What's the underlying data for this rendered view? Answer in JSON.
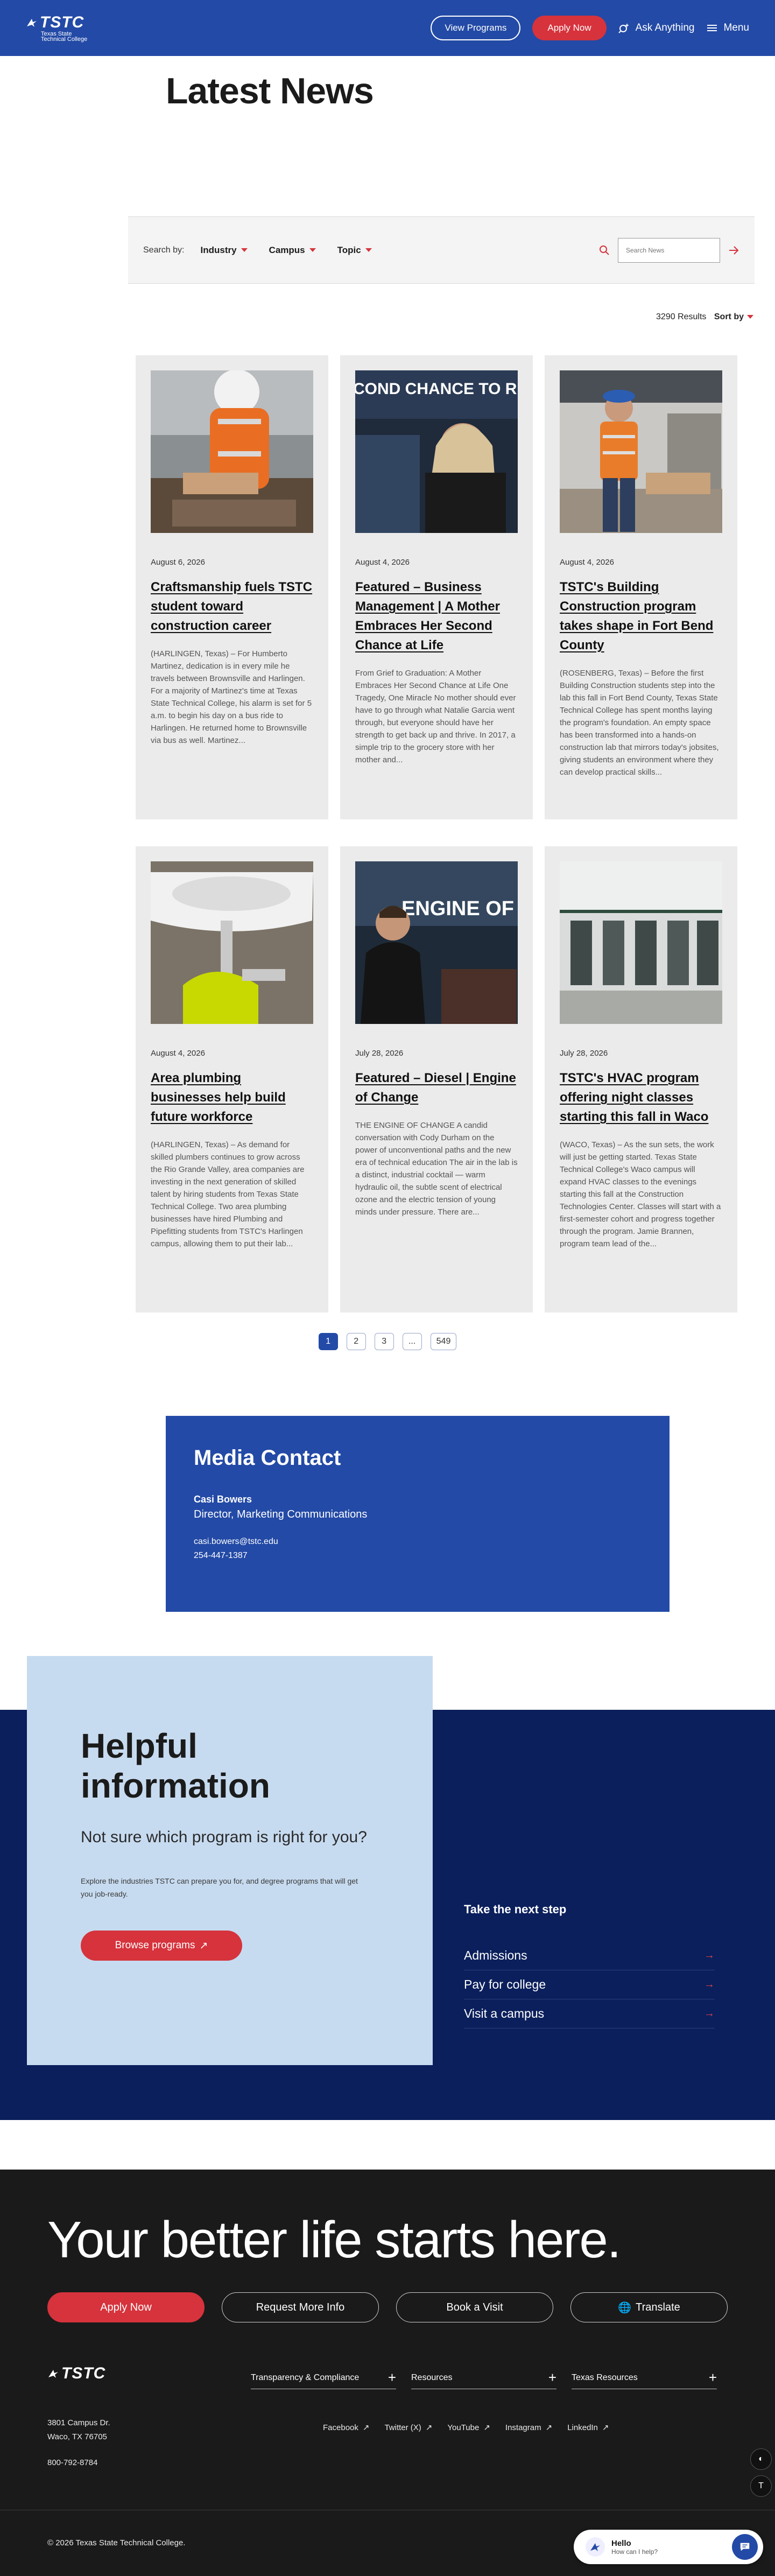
{
  "header": {
    "logo_text": "TSTC",
    "logo_sub_line1": "Texas State",
    "logo_sub_line2": "Technical College",
    "view_programs": "View Programs",
    "apply_now": "Apply Now",
    "ask_anything": "Ask Anything",
    "menu": "Menu"
  },
  "page_title": "Latest News",
  "filters": {
    "label": "Search by:",
    "items": [
      "Industry",
      "Campus",
      "Topic"
    ],
    "search_placeholder": "Search News"
  },
  "results": {
    "count": "3290 Results",
    "sort_label": "Sort by"
  },
  "cards": [
    {
      "date": "August 6, 2026",
      "title": "Craftsmanship fuels TSTC student toward construction career",
      "excerpt": "(HARLINGEN, Texas) – For Humberto Martinez, dedication is in every mile he travels between Brownsville and Harlingen. For a majority of Martinez's time at Texas State Technical College, his alarm is set for 5 a.m. to begin his day on a bus ride to Harlingen. He returned home to Brownsville via bus as well. Martinez..."
    },
    {
      "date": "August 4, 2026",
      "title": "Featured – Business Management | A Mother Embraces Her Second Chance at Life",
      "excerpt": "From Grief to Graduation: A Mother Embraces Her Second Chance at Life One Tragedy, One Miracle No mother should ever have to go through what Natalie Garcia went through, but everyone should have her strength to get back up and thrive. In 2017, a simple trip to the grocery store with her mother and...",
      "image_text": "COND CHANCE TO RISE"
    },
    {
      "date": "August 4, 2026",
      "title": "TSTC's Building Construction program takes shape in Fort Bend County",
      "excerpt": "(ROSENBERG, Texas) – Before the first Building Construction students step into the lab this fall in Fort Bend County, Texas State Technical College has spent months laying the program's foundation. An empty space has been transformed into a hands-on construction lab that mirrors today's jobsites, giving students an environment where they can develop practical skills..."
    },
    {
      "date": "August 4, 2026",
      "title": "Area plumbing businesses help build future workforce",
      "excerpt": "(HARLINGEN, Texas) – As demand for skilled plumbers continues to grow across the Rio Grande Valley, area companies are investing in the next generation of skilled talent by hiring students from Texas State Technical College. Two area plumbing businesses have hired Plumbing and Pipefitting students from TSTC's Harlingen campus, allowing them to put their lab..."
    },
    {
      "date": "July 28, 2026",
      "title": "Featured – Diesel | Engine of Change",
      "excerpt": "THE ENGINE OF CHANGE A candid conversation with Cody Durham on the power of unconventional paths and the new era of technical education   The air in the lab is a distinct, industrial cocktail — warm hydraulic oil, the subtle scent of electrical ozone and the electric tension of young minds under pressure. There are...",
      "image_text": "ENGINE OF CHA"
    },
    {
      "date": "July 28, 2026",
      "title": "TSTC's HVAC program offering night classes starting this fall in Waco",
      "excerpt": "(WACO, Texas) – As the sun sets, the work will just be getting started. Texas State Technical College's Waco campus will expand HVAC classes to the evenings starting this fall at the Construction Technologies Center. Classes will start with a first-semester cohort and progress together through the program. Jamie Brannen, program team lead of the..."
    }
  ],
  "pagination": [
    "1",
    "2",
    "3",
    "...",
    "549"
  ],
  "media_contact": {
    "title": "Media Contact",
    "name": "Casi Bowers",
    "role": "Director, Marketing Communications",
    "email": "casi.bowers@tstc.edu",
    "phone": "254-447-1387"
  },
  "helpful": {
    "title": "Helpful information",
    "subtitle": "Not sure which program is right for you?",
    "text": "Explore the industries TSTC can prepare you for, and degree programs that will get you job-ready.",
    "button": "Browse programs"
  },
  "next_step": {
    "title": "Take the next step",
    "links": [
      "Admissions",
      "Pay for college",
      "Visit a campus"
    ]
  },
  "footer": {
    "hero": "Your better life starts here.",
    "buttons": [
      "Apply Now",
      "Request More Info",
      "Book a Visit",
      "Translate"
    ],
    "accordion": [
      "Transparency & Compliance",
      "Resources",
      "Texas Resources"
    ],
    "address_line1": "3801 Campus Dr.",
    "address_line2": "Waco, TX 76705",
    "phone": "800-792-8784",
    "social": [
      "Facebook",
      "Twitter (X)",
      "YouTube",
      "Instagram",
      "LinkedIn"
    ],
    "copyright": "© 2026 Texas State Technical College."
  },
  "chat": {
    "title": "Hello",
    "subtitle": "How can I help?"
  },
  "colors": {
    "brand_blue": "#234aa6",
    "navy": "#0b1f5c",
    "red": "#d6333c",
    "light_blue": "#c7dbf0",
    "footer_bg": "#1a1a1a"
  }
}
